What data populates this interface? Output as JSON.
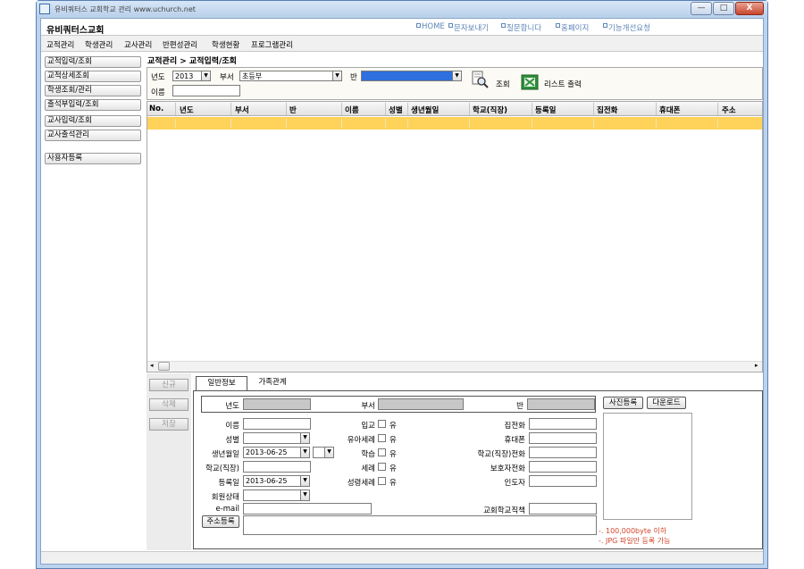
{
  "window": {
    "title": "유비쿼터스 교회학교 관리 www.uchurch.net",
    "min_label": "—",
    "max_label": "□",
    "close_label": "X"
  },
  "app": {
    "name": "유비쿼터스교회"
  },
  "top_links": [
    "HOME",
    "문자보내기",
    "질문합니다",
    "홈페이지",
    "기능개선요청"
  ],
  "menu": [
    "교적관리",
    "학생관리",
    "교사관리",
    "반편성관리",
    "학생현황",
    "프로그램관리"
  ],
  "sidebar": [
    "교적입력/조회",
    "교적상세조회",
    "학생조회/관리",
    "출석부입력/조회",
    "교사입력/조회",
    "교사출석관리",
    "사용자등록"
  ],
  "breadcrumb": "교적관리 > 교적입력/조회",
  "search": {
    "year_label": "년도",
    "year_value": "2013",
    "dept_label": "부서",
    "dept_value": "초등부",
    "class_label": "반",
    "class_value": "",
    "name_label": "이름",
    "name_value": "",
    "search_button": "조회",
    "export_button": "리스트 출력"
  },
  "grid": {
    "columns": [
      "No.",
      "년도",
      "부서",
      "반",
      "이름",
      "성별",
      "생년월일",
      "학교(직장)",
      "등록일",
      "집전화",
      "휴대폰",
      "주소"
    ],
    "selected_row_color": "#ffd35a"
  },
  "buttons": {
    "new": "신규",
    "delete": "삭제",
    "save": "저장"
  },
  "tabs": [
    "일반정보",
    "가족관계"
  ],
  "detail": {
    "year_label": "년도",
    "dept_label": "부서",
    "class_label": "반",
    "photo_register": "사진등록",
    "download": "다운로드",
    "name_label": "이름",
    "gender_label": "성별",
    "birth_label": "생년월일",
    "birth_value": "2013-06-25",
    "school_label": "학교(직장)",
    "reg_label": "등록일",
    "reg_value": "2013-06-25",
    "member_status_label": "회원상태",
    "email_label": "e-mail",
    "address_button": "주소등록",
    "chk_labels": [
      "입교",
      "유아세례",
      "학습",
      "세례",
      "성령세례"
    ],
    "chk_value_label": "유",
    "home_phone_label": "집전화",
    "mobile_label": "휴대폰",
    "school_phone_label": "학교(직장)전화",
    "guardian_phone_label": "보호자전화",
    "guide_label": "인도자",
    "church_title_label": "교회학교직책",
    "photo_notes": [
      "-. 100,000byte 이하",
      "-. JPG 파일만 등록 가능"
    ]
  }
}
